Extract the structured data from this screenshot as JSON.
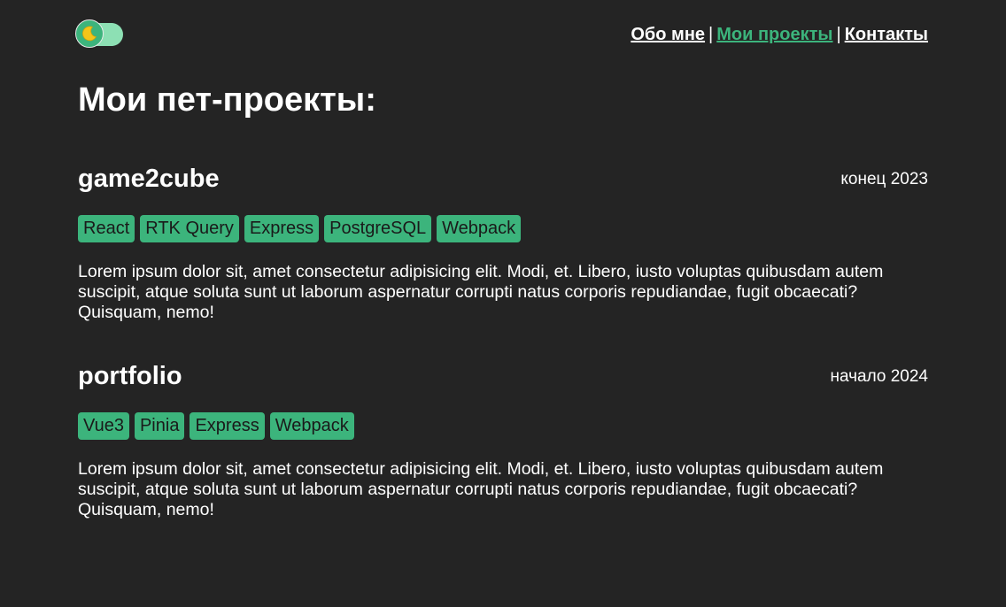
{
  "theme_toggle": {
    "icon": "moon-icon",
    "glyph": "🌙"
  },
  "nav": {
    "items": [
      {
        "label": "Обо мне",
        "active": false
      },
      {
        "label": "Мои проекты",
        "active": true
      },
      {
        "label": "Контакты",
        "active": false
      }
    ],
    "separator": "|"
  },
  "page_title": "Мои пет-проекты:",
  "projects": [
    {
      "name": "game2cube",
      "date": "конец 2023",
      "tags": [
        "React",
        "RTK Query",
        "Express",
        "PostgreSQL",
        "Webpack"
      ],
      "description": "Lorem ipsum dolor sit, amet consectetur adipisicing elit. Modi, et. Libero, iusto voluptas quibusdam autem suscipit, atque soluta sunt ut laborum aspernatur corrupti natus corporis repudiandae, fugit obcaecati? Quisquam, nemo!"
    },
    {
      "name": "portfolio",
      "date": "начало 2024",
      "tags": [
        "Vue3",
        "Pinia",
        "Express",
        "Webpack"
      ],
      "description": "Lorem ipsum dolor sit, amet consectetur adipisicing elit. Modi, et. Libero, iusto voluptas quibusdam autem suscipit, atque soluta sunt ut laborum aspernatur corrupti natus corporis repudiandae, fugit obcaecati? Quisquam, nemo!"
    }
  ],
  "colors": {
    "background": "#242424",
    "accent": "#3cb47c",
    "text": "#ffffff"
  }
}
